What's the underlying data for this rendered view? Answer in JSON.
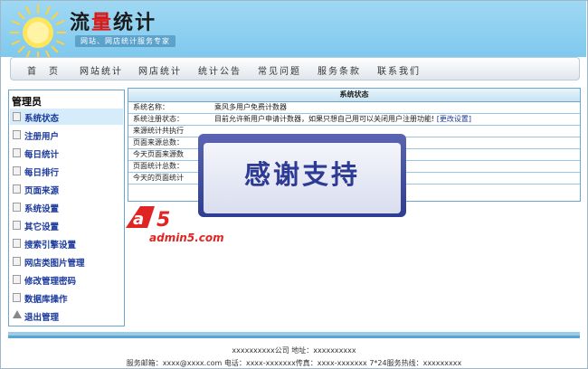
{
  "header": {
    "logo": "流量统计",
    "logo_highlight_char": "量",
    "slogan": "网站、网店统计服务专家"
  },
  "nav": {
    "items": [
      "首　页",
      "网站统计",
      "网店统计",
      "统计公告",
      "常见问题",
      "服务条款",
      "联系我们"
    ]
  },
  "sidebar": {
    "title": "管理员",
    "items": [
      {
        "label": "系统状态",
        "icon": "page-icon"
      },
      {
        "label": "注册用户",
        "icon": "page-icon"
      },
      {
        "label": "每日统计",
        "icon": "page-icon"
      },
      {
        "label": "每日排行",
        "icon": "page-icon"
      },
      {
        "label": "页面来源",
        "icon": "page-icon"
      },
      {
        "label": "系统设置",
        "icon": "page-icon"
      },
      {
        "label": "其它设置",
        "icon": "page-icon"
      },
      {
        "label": "搜索引擎设置",
        "icon": "page-icon"
      },
      {
        "label": "网店类图片管理",
        "icon": "page-icon"
      },
      {
        "label": "修改管理密码",
        "icon": "page-icon"
      },
      {
        "label": "数据库操作",
        "icon": "page-icon"
      },
      {
        "label": "退出管理",
        "icon": "warning-icon"
      }
    ]
  },
  "status": {
    "title": "系统状态",
    "rows": [
      {
        "key": "系统名称：",
        "value": "乘风多用户免费计数器"
      },
      {
        "key": "系统注册状态：",
        "value": "目前允许新用户申请计数器，如果只想自己用可以关闭用户注册功能!",
        "link": "[更改设置]"
      },
      {
        "key": "来源统计共执行",
        "value": ""
      },
      {
        "key": "页面来源总数：",
        "value": ""
      },
      {
        "key": "今天页面来源数",
        "value": ""
      },
      {
        "key": "页面统计总数：",
        "value": ""
      },
      {
        "key": "今天的页面统计",
        "value": ""
      }
    ]
  },
  "overlay": {
    "banner_text": "感谢支持",
    "watermark_text": "admin5.com"
  },
  "footer": {
    "line1": "xxxxxxxxxx公司 地址：xxxxxxxxxx",
    "line2": "服务邮箱：xxxx@xxxx.com 电话：xxxx-xxxxxxx传真：xxxx-xxxxxxx 7*24服务热线：xxxxxxxxx"
  },
  "colors": {
    "header_bg": "#8fd2f1",
    "menu_text": "#1b3a9c",
    "panel_border": "#6aa6cf",
    "banner": "#2e3b94",
    "watermark": "#e02424"
  }
}
